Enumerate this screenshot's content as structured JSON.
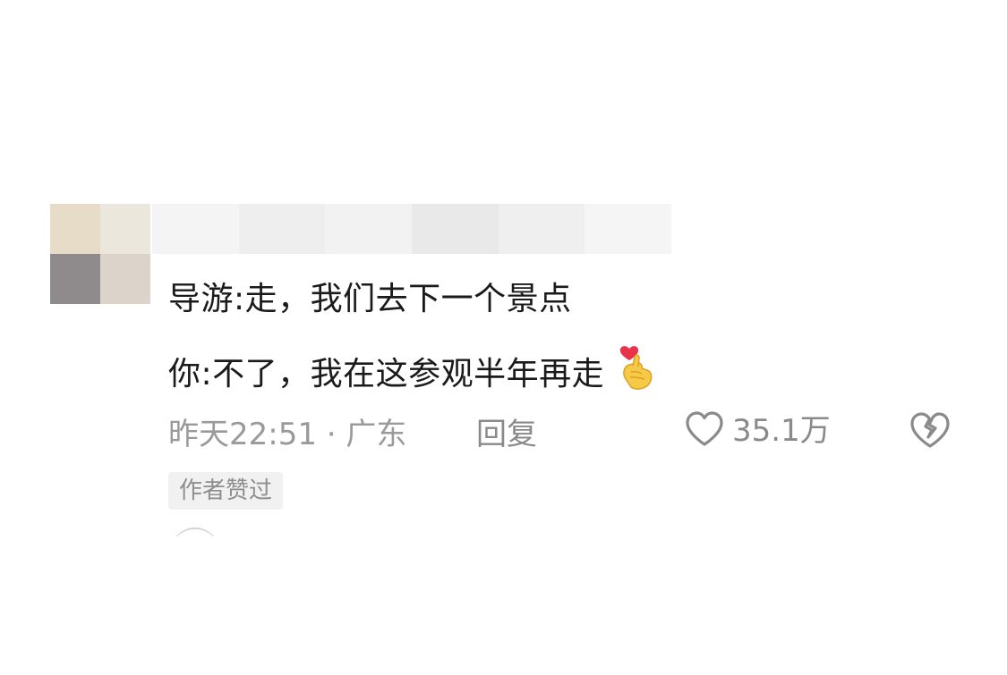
{
  "comment": {
    "lines": [
      "导游:走，我们去下一个景点",
      "你:不了，我在这参观半年再走"
    ],
    "emoji": "heart-finger-emoji",
    "time_location": "昨天22:51 · 广东",
    "reply_label": "回复",
    "like_count": "35.1万",
    "badge": "作者赞过"
  },
  "colors": {
    "text": "#1a1a1a",
    "meta": "#9a9a9a",
    "badge_bg": "#f1f1f1",
    "heart": "#e8334a",
    "emoji_hand": "#f7c948"
  }
}
